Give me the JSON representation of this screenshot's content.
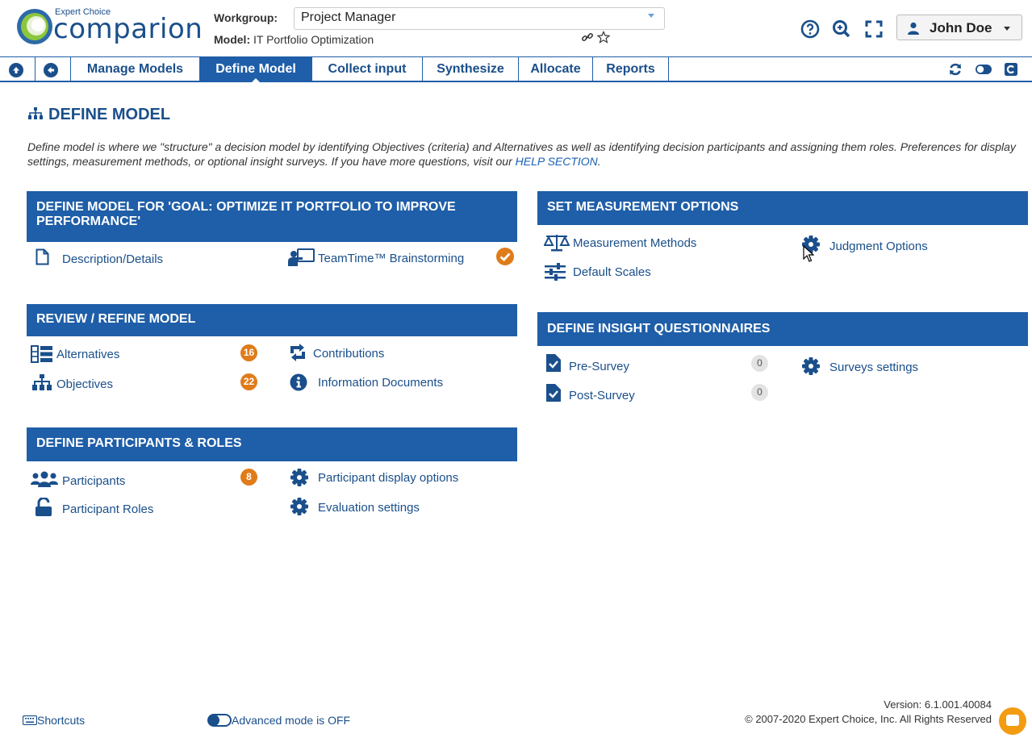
{
  "header": {
    "logo_subtitle": "Expert Choice",
    "logo_main": "comparion",
    "workgroup_label": "Workgroup:",
    "workgroup_value": "Project Manager",
    "model_label": "Model:",
    "model_value": "IT Portfolio Optimization",
    "user_name": "John Doe"
  },
  "nav": {
    "tabs": [
      {
        "label": "Manage Models"
      },
      {
        "label": "Define Model",
        "active": true
      },
      {
        "label": "Collect input"
      },
      {
        "label": "Synthesize"
      },
      {
        "label": "Allocate"
      },
      {
        "label": "Reports"
      }
    ]
  },
  "page": {
    "title": "DEFINE MODEL",
    "intro": "Define model is where we \"structure\" a decision model by identifying Objectives (criteria) and Alternatives as well as identifying decision participants and assigning them roles. Preferences for display settings, measurement methods, or optional insight surveys. If you have more questions, visit our ",
    "help_link": "HELP SECTION",
    "intro_end": "."
  },
  "define_for_goal": {
    "heading": "DEFINE MODEL FOR 'GOAL: OPTIMIZE IT PORTFOLIO TO IMPROVE PERFORMANCE'",
    "description": "Description/Details",
    "brainstorming": "TeamTime™ Brainstorming"
  },
  "review_refine": {
    "heading": "REVIEW / REFINE MODEL",
    "alternatives": "Alternatives",
    "alternatives_count": "16",
    "objectives": "Objectives",
    "objectives_count": "22",
    "contributions": "Contributions",
    "information_documents": "Information Documents"
  },
  "participants_roles": {
    "heading": "DEFINE PARTICIPANTS & ROLES",
    "participants": "Participants",
    "participants_count": "8",
    "participant_roles": "Participant Roles",
    "display_options": "Participant display options",
    "evaluation_settings": "Evaluation settings"
  },
  "measurement": {
    "heading": "SET MEASUREMENT OPTIONS",
    "methods": "Measurement Methods",
    "scales": "Default Scales",
    "judgment_options": "Judgment Options"
  },
  "insight": {
    "heading": "DEFINE INSIGHT QUESTIONNAIRES",
    "pre_survey": "Pre-Survey",
    "pre_survey_count": "0",
    "post_survey": "Post-Survey",
    "post_survey_count": "0",
    "surveys_settings": "Surveys settings"
  },
  "footer": {
    "shortcuts": "Shortcuts",
    "advanced_mode": "Advanced mode is OFF",
    "version": "Version: 6.1.001.40084",
    "copyright": "© 2007-2020 Expert Choice, Inc. All Rights Reserved"
  },
  "colors": {
    "brand_blue": "#1f5ea8",
    "link_blue": "#1a4f8b",
    "badge_orange": "#e07b1a"
  }
}
